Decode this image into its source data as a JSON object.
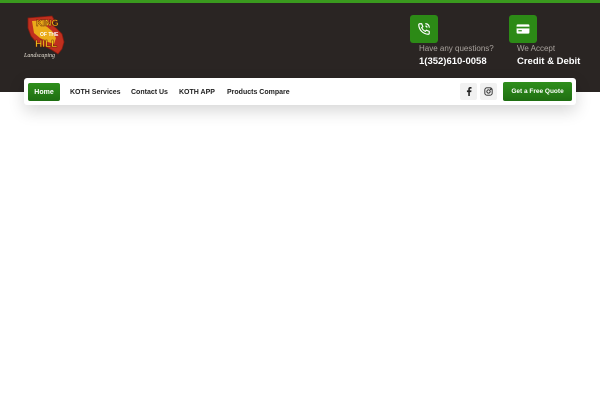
{
  "brand": {
    "logo_text_top": "KING",
    "logo_text_mid": "OF THE",
    "logo_text_bottom": "HILL",
    "logo_subtitle": "Landscaping"
  },
  "contact": {
    "phone_label": "Have any questions?",
    "phone_value": "1(352)610-0058",
    "phone_icon": "phone-icon"
  },
  "payment": {
    "label": "We Accept",
    "value": "Credit & Debit",
    "icon": "credit-card-icon"
  },
  "nav": {
    "home": "Home",
    "services": "KOTH Services",
    "contact": "Contact Us",
    "app": "KOTH APP",
    "compare": "Products Compare"
  },
  "social": {
    "facebook": "facebook-icon",
    "instagram": "instagram-icon"
  },
  "cta": {
    "quote_label": "Get a Free Quote"
  },
  "colors": {
    "accent_green": "#2c8a16",
    "header_dark": "#2a2523",
    "logo_red": "#c0301e",
    "logo_yellow": "#f2c21a"
  }
}
